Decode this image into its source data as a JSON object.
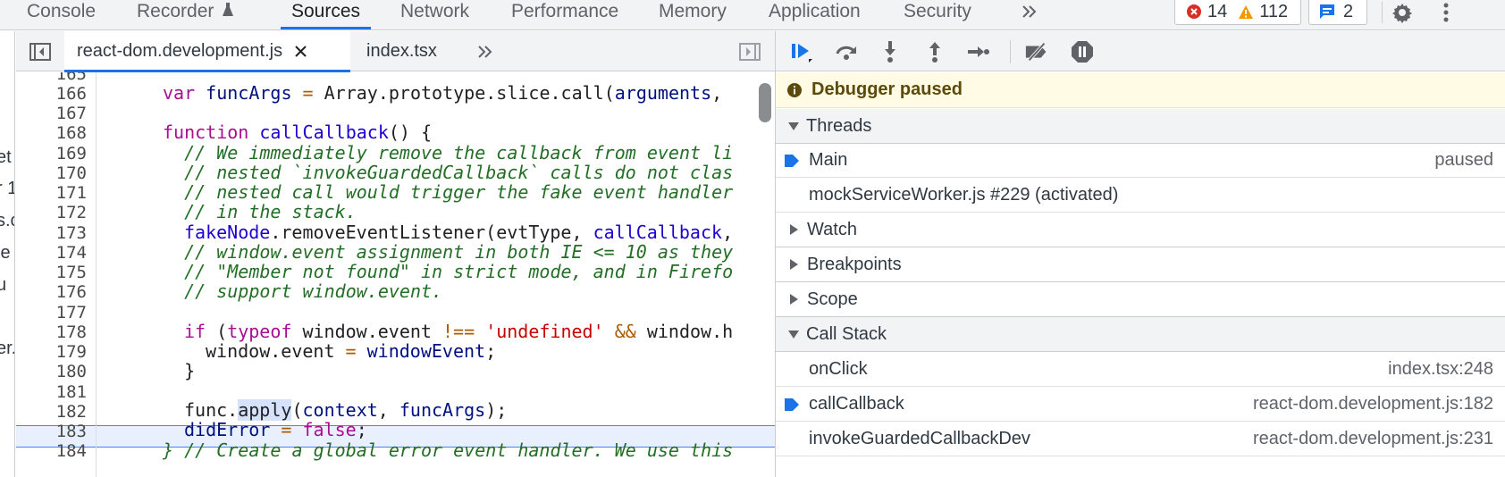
{
  "top_tabs": [
    {
      "label": "Console"
    },
    {
      "label": "Recorder"
    },
    {
      "label": "Sources"
    },
    {
      "label": "Network"
    },
    {
      "label": "Performance"
    },
    {
      "label": "Memory"
    },
    {
      "label": "Application"
    },
    {
      "label": "Security"
    }
  ],
  "counters": {
    "errors": "14",
    "warnings": "112",
    "messages": "2"
  },
  "icons": {
    "more_tabs": "double-chevron-right-icon",
    "error": "error-circle-icon",
    "warning": "warning-triangle-icon",
    "message": "message-bubble-icon",
    "settings": "gear-icon",
    "menu": "kebab-menu-icon",
    "recorder": "flask-icon"
  },
  "nav_strip_fragments": [
    "et",
    "r 1",
    "s.c",
    "je",
    "u",
    "er."
  ],
  "editor_tabs": [
    {
      "label": "react-dom.development.js",
      "closable": true
    },
    {
      "label": "index.tsx",
      "closable": false
    }
  ],
  "code": {
    "lines": [
      {
        "n": "165",
        "text": ""
      },
      {
        "n": "166",
        "text": ""
      },
      {
        "n": "167",
        "text": ""
      },
      {
        "n": "168",
        "text": ""
      },
      {
        "n": "169",
        "text": "  // We immediately remove the callback from event li"
      },
      {
        "n": "170",
        "text": "  // nested `invokeGuardedCallback` calls do not clas"
      },
      {
        "n": "171",
        "text": "  // nested call would trigger the fake event handler"
      },
      {
        "n": "172",
        "text": "  // in the stack."
      },
      {
        "n": "173",
        "text": ""
      },
      {
        "n": "174",
        "text": "  // window.event assignment in both IE <= 10 as they"
      },
      {
        "n": "175",
        "text": "  // \"Member not found\" in strict mode, and in Firefo"
      },
      {
        "n": "176",
        "text": "  // support window.event."
      },
      {
        "n": "177",
        "text": ""
      },
      {
        "n": "178",
        "text": ""
      },
      {
        "n": "179",
        "text": ""
      },
      {
        "n": "180",
        "text": "  }"
      },
      {
        "n": "181",
        "text": ""
      },
      {
        "n": "182",
        "text": ""
      },
      {
        "n": "183",
        "text": ""
      },
      {
        "n": "184",
        "text": ""
      }
    ],
    "l166": {
      "kw": "var",
      "name": "funcArgs",
      "eq": "=",
      "rest": "Array.prototype.slice.call(",
      "arg": "arguments",
      "tail": ","
    },
    "l168": {
      "kw": "function",
      "name": "callCallback",
      "tail": "() {"
    },
    "l173": {
      "obj": "fakeNode",
      "call": ".removeEventListener(evtType, ",
      "arg": "callCallback",
      "tail": ","
    },
    "l178": {
      "kw": "if",
      "open": " (",
      "typeof": "typeof",
      "mid": " window.event ",
      "neq": "!==",
      "str": "'undefined'",
      "and": "&&",
      "tail": " window.h"
    },
    "l179": {
      "lhs": "window.event",
      "eq": "=",
      "rhs": "windowEvent",
      "tail": ";"
    },
    "l182": {
      "obj": "func.",
      "method": "apply",
      "open": "(",
      "a1": "context",
      "sep": ", ",
      "a2": "funcArgs",
      "tail": ");"
    },
    "l183": {
      "name": "didError",
      "eq": "=",
      "val": "false",
      "tail": ";"
    },
    "l184": {
      "text": "} // Create a global error event handler. We use this"
    }
  },
  "debugger": {
    "toolbar_icons": [
      "resume-icon",
      "step-over-icon",
      "step-into-icon",
      "step-out-icon",
      "step-icon",
      "deactivate-breakpoints-icon",
      "pause-on-exceptions-icon"
    ],
    "paused_label": "Debugger paused",
    "sections": {
      "threads": "Threads",
      "watch": "Watch",
      "breakpoints": "Breakpoints",
      "scope": "Scope",
      "call_stack": "Call Stack"
    },
    "threads": [
      {
        "name": "Main",
        "status": "paused",
        "current": true
      },
      {
        "name": "mockServiceWorker.js #229 (activated)",
        "status": "",
        "current": false
      }
    ],
    "call_stack": [
      {
        "fn": "onClick",
        "loc": "index.tsx:248",
        "current": false
      },
      {
        "fn": "callCallback",
        "loc": "react-dom.development.js:182",
        "current": true
      },
      {
        "fn": "invokeGuardedCallbackDev",
        "loc": "react-dom.development.js:231",
        "current": false
      }
    ]
  }
}
